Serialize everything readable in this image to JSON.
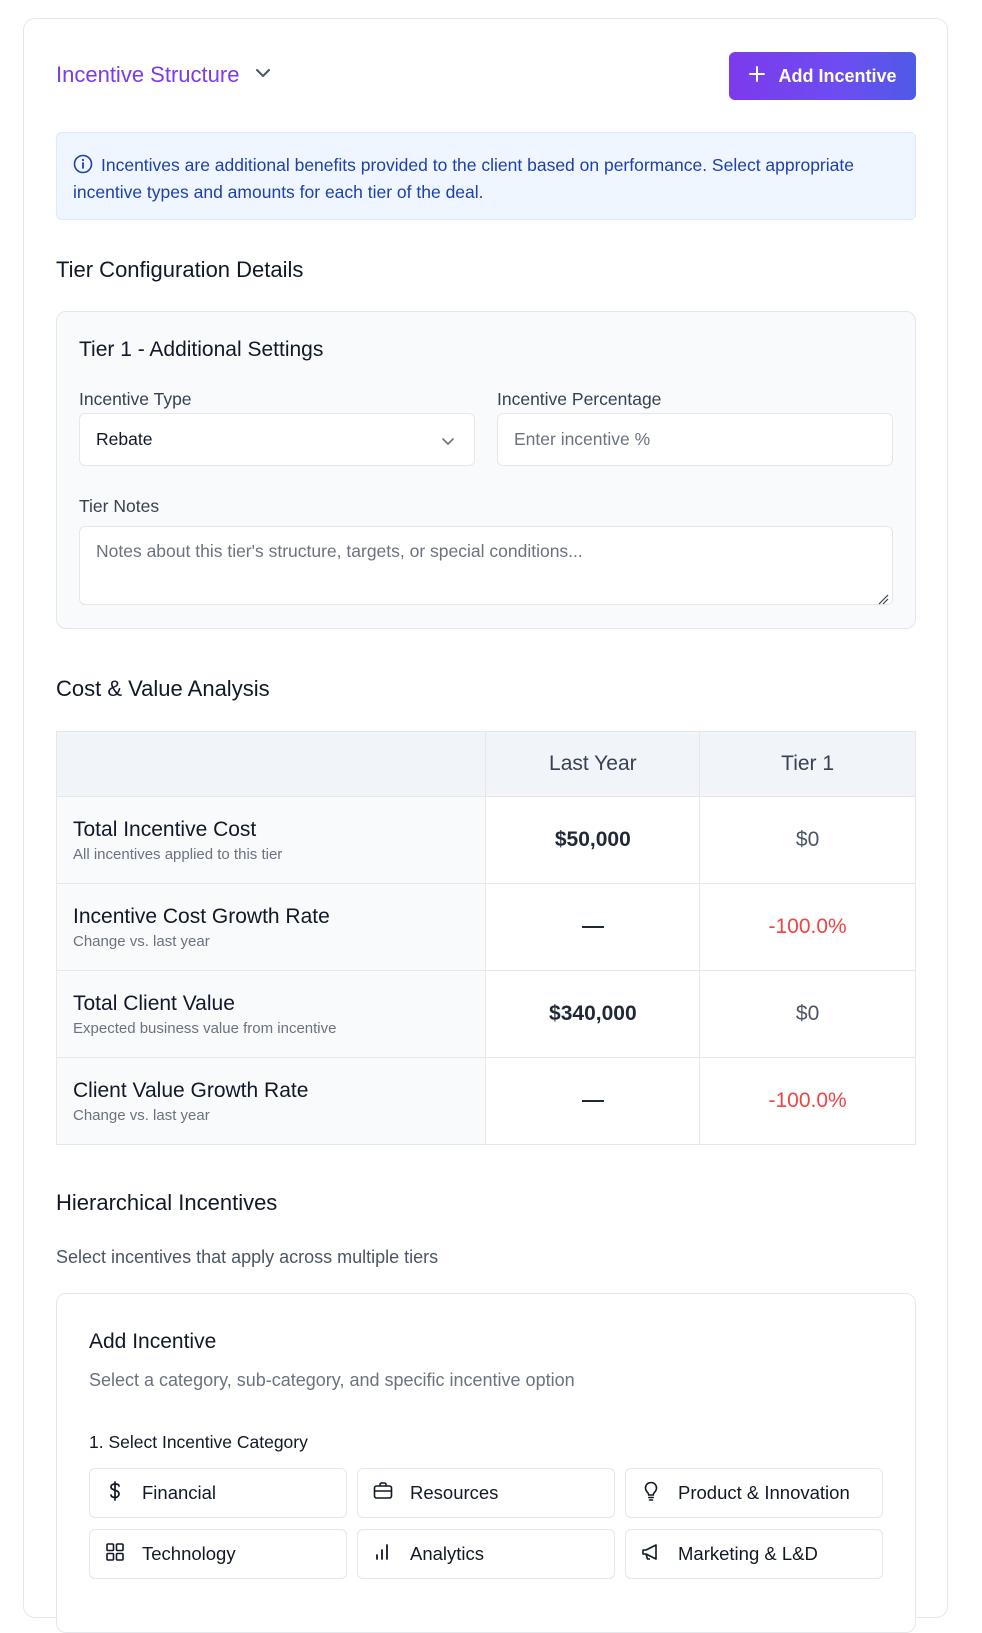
{
  "header": {
    "title": "Incentive Structure",
    "add_button_label": "Add Incentive"
  },
  "info_banner": {
    "text": "Incentives are additional benefits provided to the client based on performance. Select appropriate incentive types and amounts for each tier of the deal."
  },
  "tier_config": {
    "section_title": "Tier Configuration Details",
    "panel_title": "Tier 1 - Additional Settings",
    "incentive_type_label": "Incentive Type",
    "incentive_type_value": "Rebate",
    "incentive_percentage_label": "Incentive Percentage",
    "incentive_percentage_placeholder": "Enter incentive %",
    "tier_notes_label": "Tier Notes",
    "tier_notes_placeholder": "Notes about this tier's structure, targets, or special conditions..."
  },
  "cost_value": {
    "section_title": "Cost & Value Analysis",
    "columns": [
      "",
      "Last Year",
      "Tier 1"
    ],
    "rows": [
      {
        "title": "Total Incentive Cost",
        "subtitle": "All incentives applied to this tier",
        "last_year": "$50,000",
        "tier1": "$0"
      },
      {
        "title": "Incentive Cost Growth Rate",
        "subtitle": "Change vs. last year",
        "last_year": "—",
        "tier1": "-100.0%"
      },
      {
        "title": "Total Client Value",
        "subtitle": "Expected business value from incentive",
        "last_year": "$340,000",
        "tier1": "$0"
      },
      {
        "title": "Client Value Growth Rate",
        "subtitle": "Change vs. last year",
        "last_year": "—",
        "tier1": "-100.0%"
      }
    ]
  },
  "hierarchical": {
    "section_title": "Hierarchical Incentives",
    "description": "Select incentives that apply across multiple tiers",
    "panel_title": "Add Incentive",
    "panel_description": "Select a category, sub-category, and specific incentive option",
    "step_label": "1. Select Incentive Category",
    "categories": [
      {
        "label": "Financial",
        "icon": "dollar-icon"
      },
      {
        "label": "Resources",
        "icon": "briefcase-icon"
      },
      {
        "label": "Product & Innovation",
        "icon": "lightbulb-icon"
      },
      {
        "label": "Technology",
        "icon": "grid-icon"
      },
      {
        "label": "Analytics",
        "icon": "bar-chart-icon"
      },
      {
        "label": "Marketing & L&D",
        "icon": "megaphone-icon"
      }
    ]
  },
  "colors": {
    "accent": "#7c3aed",
    "info_bg": "#eff6ff",
    "info_text": "#1e40af",
    "negative": "#ef4444"
  }
}
